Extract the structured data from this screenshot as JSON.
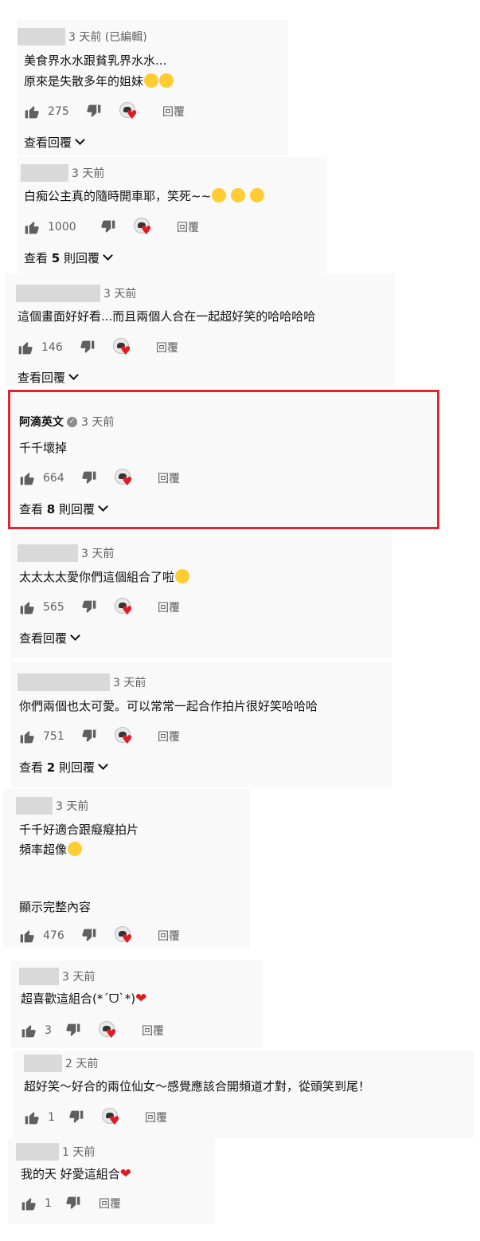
{
  "comments": [
    {
      "author": "",
      "time": "3 天前 (已編輯)",
      "lines": [
        "美食界水水跟貧乳界水水...",
        "原來是失散多年的姐妹"
      ],
      "likes": "275",
      "reply": "回覆",
      "view_replies": "查看回覆",
      "reply_count": ""
    },
    {
      "author": "",
      "time": "3 天前",
      "lines": [
        "白痴公主真的隨時開車耶，笑死~~"
      ],
      "likes": "1000",
      "reply": "回覆",
      "view_replies_prefix": "查看",
      "reply_count": "5",
      "view_replies_suffix": "則回覆"
    },
    {
      "author": "",
      "time": "3 天前",
      "lines": [
        "這個畫面好好看...而且兩個人合在一起超好笑的哈哈哈哈"
      ],
      "likes": "146",
      "reply": "回覆",
      "view_replies": "查看回覆",
      "reply_count": ""
    },
    {
      "author": "阿滴英文",
      "verified": true,
      "time": "3 天前",
      "lines": [
        "千千壞掉"
      ],
      "likes": "664",
      "reply": "回覆",
      "view_replies_prefix": "查看",
      "reply_count": "8",
      "view_replies_suffix": "則回覆"
    },
    {
      "author": "",
      "time": "3 天前",
      "lines": [
        "太太太太愛你們這個組合了啦"
      ],
      "likes": "565",
      "reply": "回覆",
      "view_replies": "查看回覆",
      "reply_count": ""
    },
    {
      "author": "",
      "time": "3 天前",
      "lines": [
        "你們兩個也太可愛。可以常常一起合作拍片很好笑哈哈哈"
      ],
      "likes": "751",
      "reply": "回覆",
      "view_replies_prefix": "查看",
      "reply_count": "2",
      "view_replies_suffix": "則回覆"
    },
    {
      "author": "",
      "time": "3 天前",
      "lines": [
        "千千好適合跟癡癡拍片",
        "頻率超像"
      ],
      "show_more": "顯示完整內容",
      "likes": "476",
      "reply": "回覆"
    },
    {
      "author": "",
      "time": "3 天前",
      "lines": [
        "超喜歡這組合(*ˊᗜˋ*)"
      ],
      "likes": "3",
      "reply": "回覆"
    },
    {
      "author": "",
      "time": "2 天前",
      "lines": [
        "超好笑～好合的兩位仙女～感覺應該合開頻道才對，從頭笑到尾！"
      ],
      "likes": "1",
      "reply": "回覆"
    },
    {
      "author": "",
      "time": "1 天前",
      "lines": [
        "我的天 好愛這組合"
      ],
      "likes": "1",
      "reply": "回覆"
    }
  ],
  "icons": {
    "like": "thumbs-up-icon",
    "dislike": "thumbs-down-icon",
    "creator_heart": "creator-heart-icon",
    "verified": "verified-check-icon",
    "chevron": "chevron-down-icon"
  },
  "colors": {
    "highlight_border": "#e0262e",
    "heart": "#e01b24"
  }
}
